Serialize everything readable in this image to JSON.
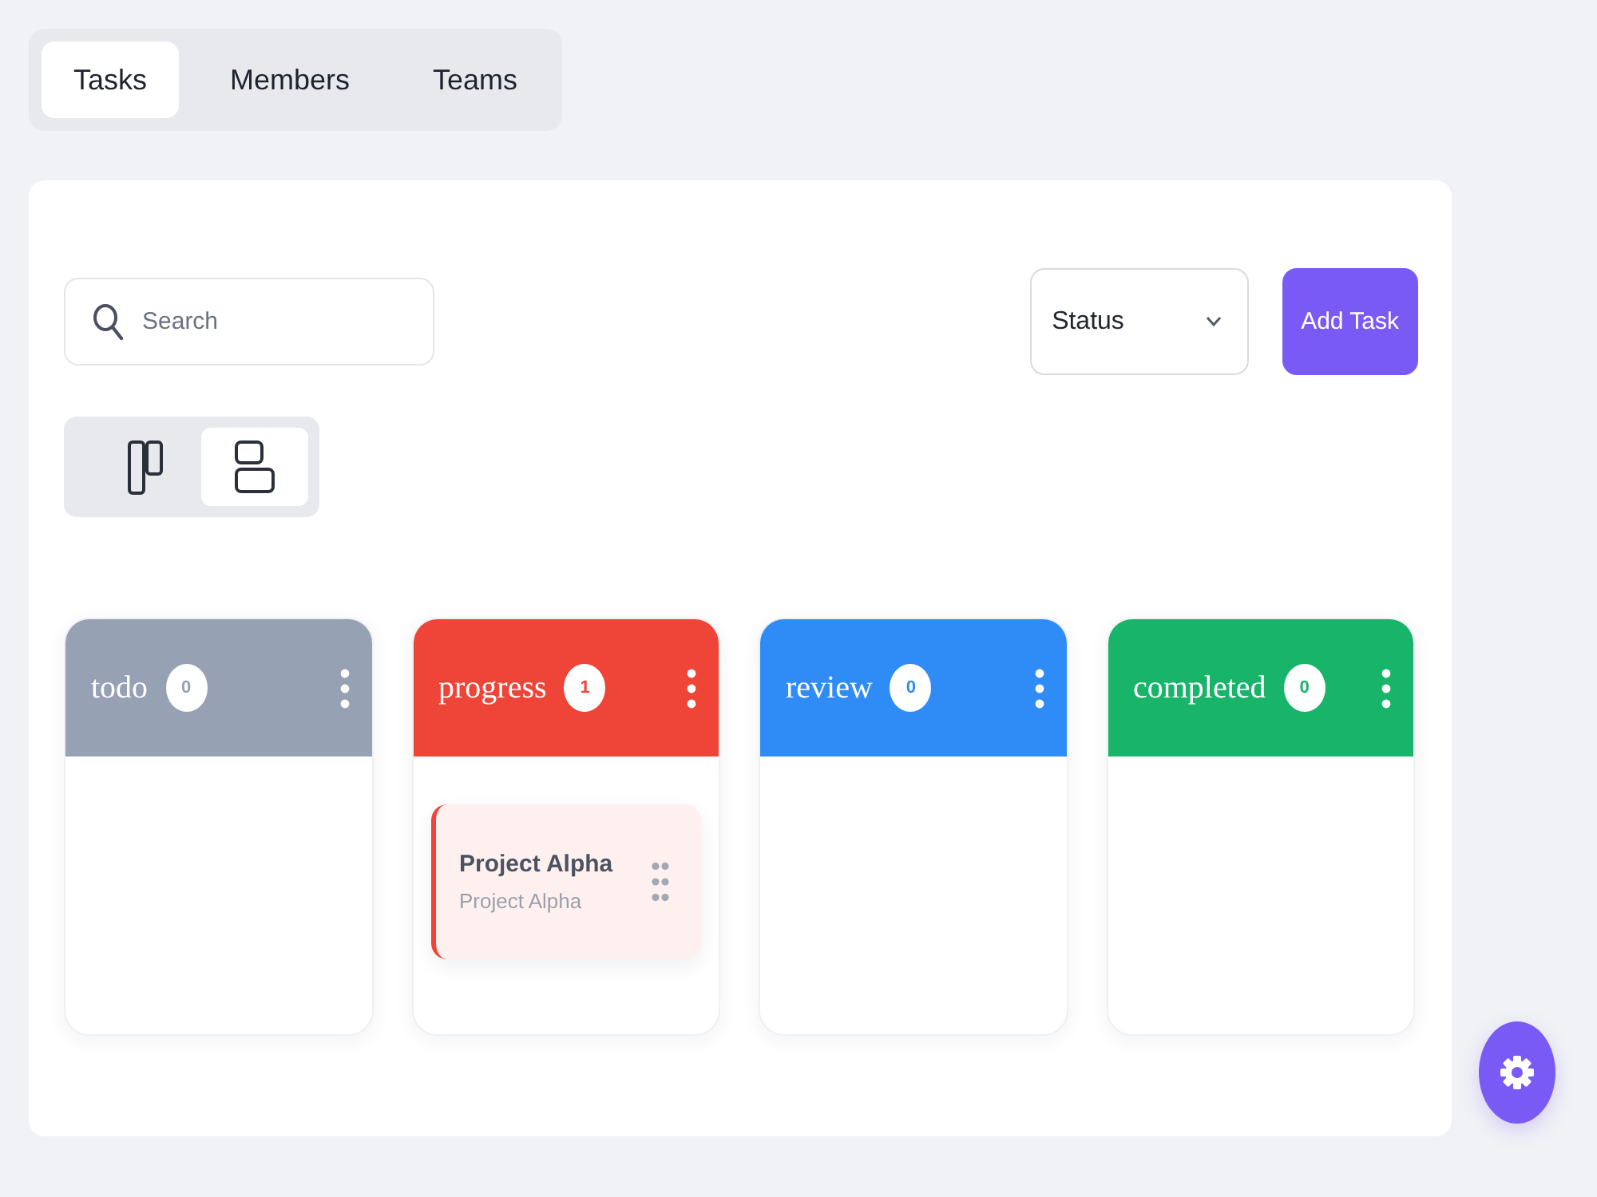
{
  "tabs": [
    {
      "label": "Tasks",
      "selected": true
    },
    {
      "label": "Members",
      "selected": false
    },
    {
      "label": "Teams",
      "selected": false
    }
  ],
  "toolbar": {
    "search": {
      "placeholder": "Search"
    },
    "status_select": {
      "value": "Status"
    },
    "add_button": "Add Task"
  },
  "view_toggle": [
    {
      "kind": "board",
      "selected": false
    },
    {
      "kind": "list",
      "selected": true
    }
  ],
  "columns": [
    {
      "title": "todo",
      "count": "0",
      "color": "#97a1b4"
    },
    {
      "title": "progress",
      "count": "1",
      "color": "#ef4438",
      "tasks": [
        {
          "title": "Project Alpha",
          "subtitle": "Project Alpha"
        }
      ]
    },
    {
      "title": "review",
      "count": "0",
      "color": "#2f8cf6"
    },
    {
      "title": "completed",
      "count": "0",
      "color": "#17b46a"
    }
  ]
}
